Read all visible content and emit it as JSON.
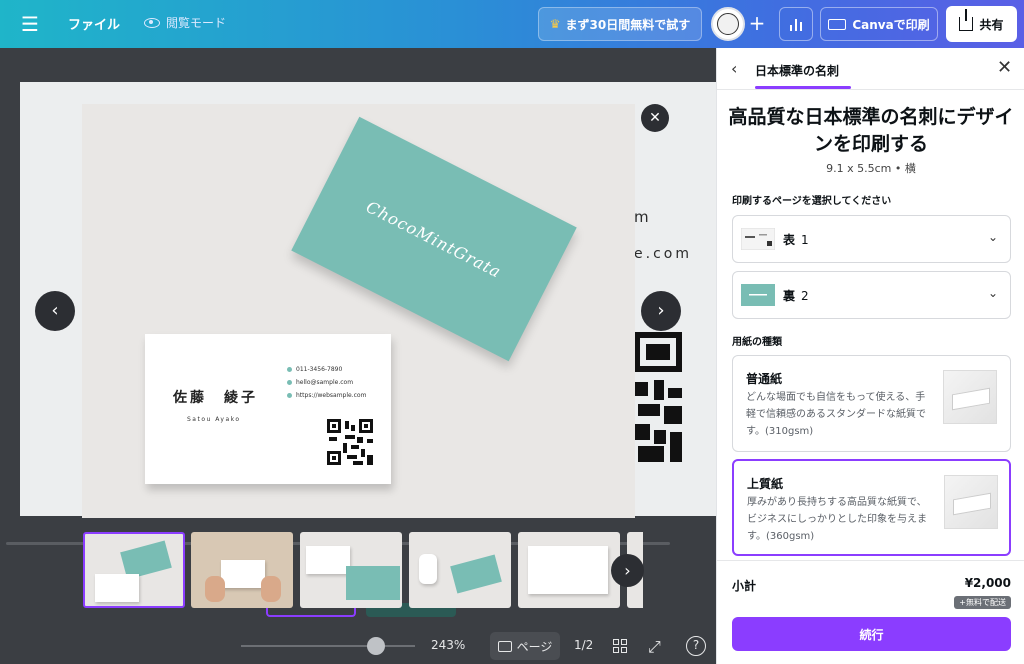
{
  "topbar": {
    "file_label": "ファイル",
    "view_mode_label": "閲覧モード",
    "trial_label": "まず30日間無料で試す",
    "print_label": "Canvaで印刷",
    "share_label": "共有"
  },
  "canvas": {
    "bg_text_1": "m",
    "bg_text_2": "e.com"
  },
  "card": {
    "logo": "ChocoMintGrata",
    "name": "佐藤　綾子",
    "romaji": "Satou Ayako",
    "phone": "011-3456-7890",
    "email": "hello@sample.com",
    "web": "https://websample.com"
  },
  "bottombar": {
    "zoom": "243%",
    "page_label": "ページ",
    "page_count": "1/2"
  },
  "panel": {
    "tab": "日本標準の名刺",
    "title": "高品質な日本標準の名刺にデザインを印刷する",
    "size": "9.1 x 5.5cm • 横",
    "pages_section": "印刷するページを選択してください",
    "pages": [
      {
        "side": "表",
        "number": "1"
      },
      {
        "side": "裏",
        "number": "2"
      }
    ],
    "paper_section": "用紙の種類",
    "papers": [
      {
        "name": "普通紙",
        "desc": "どんな場面でも自信をもって使える、手軽で信頼感のあるスタンダードな紙質です。(310gsm)"
      },
      {
        "name": "上質紙",
        "desc": "厚みがあり長持ちする高品質な紙質で、ビジネスにしっかりとした印象を与えます。(360gsm)"
      }
    ],
    "subtotal_label": "小計",
    "subtotal_value": "¥2,000",
    "shipping_badge": "+無料で配送",
    "continue_label": "続行"
  },
  "colors": {
    "accent": "#8b3dff",
    "mint": "#79bdb4"
  }
}
